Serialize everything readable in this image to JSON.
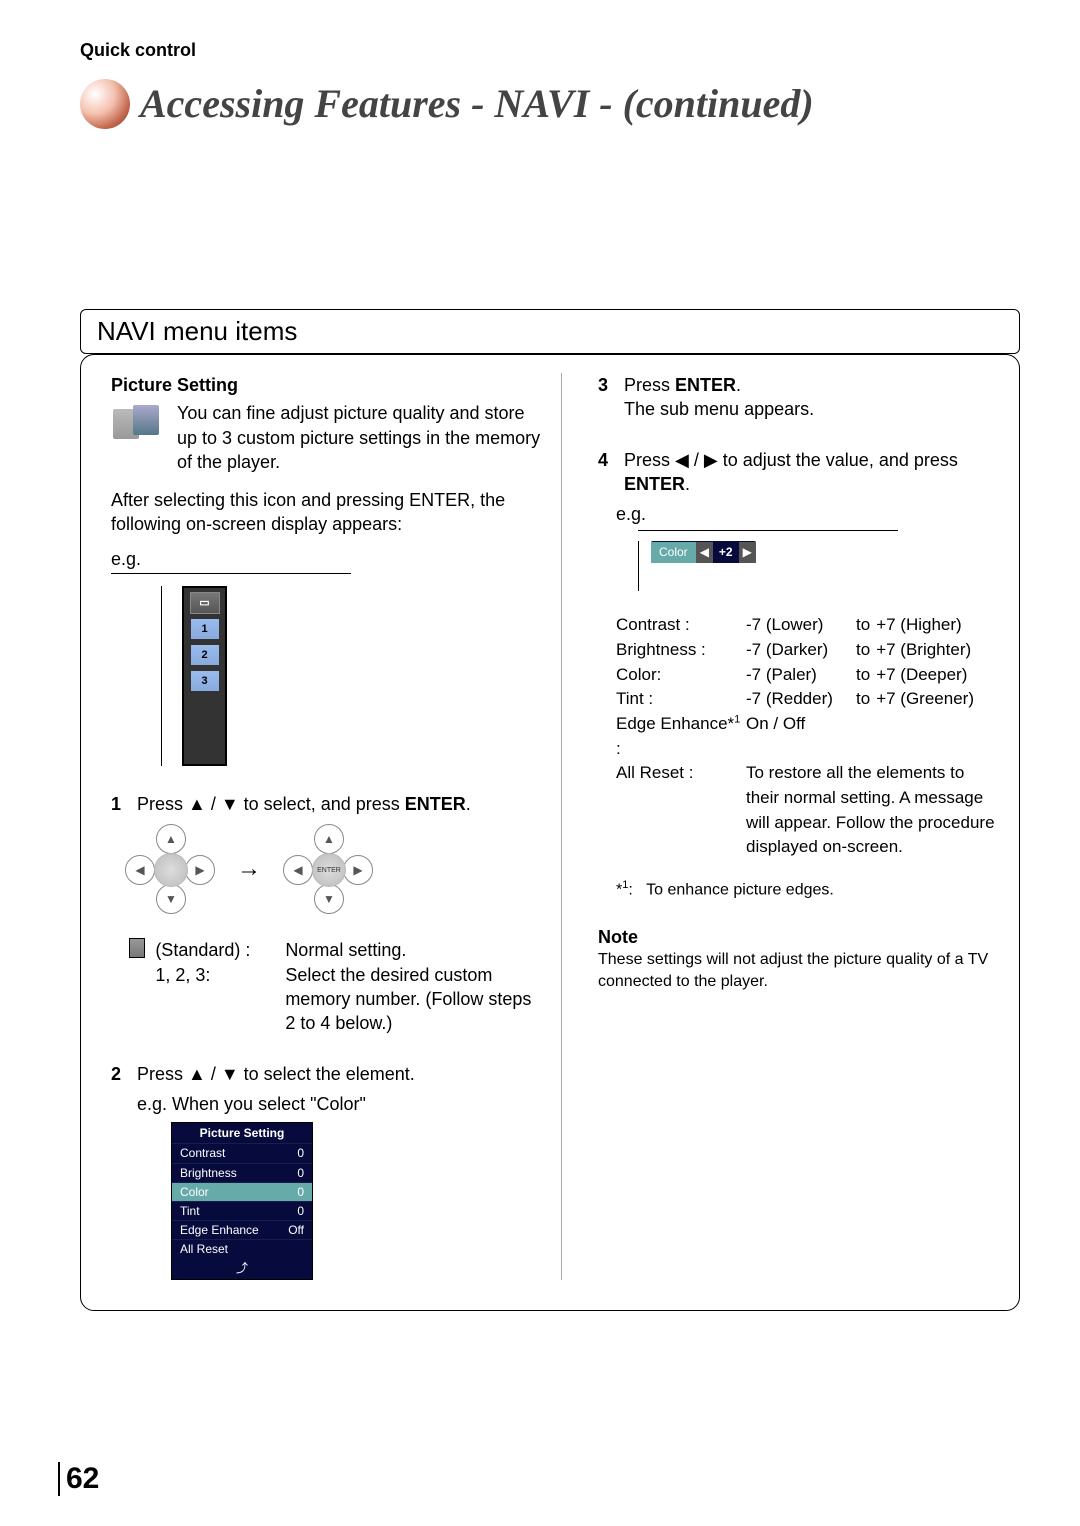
{
  "header": {
    "quick_control": "Quick control",
    "title": "Accessing Features - NAVI - (continued)"
  },
  "section_title": "NAVI menu items",
  "left": {
    "picture_setting_title": "Picture Setting",
    "picture_setting_desc": "You can fine adjust picture quality and store up to 3 custom picture settings in the memory of the player.",
    "after_selecting": "After selecting this icon and pressing ENTER, the following on-screen display appears:",
    "eg": "e.g.",
    "stack": {
      "num1": "1",
      "num2": "2",
      "num3": "3"
    },
    "step1": {
      "n": "1",
      "text_a": "Press ",
      "arrows": "▲ / ▼",
      "text_b": " to select, and press ",
      "enter": "ENTER",
      "period": "."
    },
    "dpad_center_left": "",
    "dpad_center_right": "ENTER",
    "arrow": "→",
    "std": {
      "standard_label": "(Standard) :",
      "standard_desc": "Normal setting.",
      "nums_label": "1, 2, 3:",
      "nums_desc": "Select the desired custom memory number. (Follow steps 2 to 4 below.)"
    },
    "step2": {
      "n": "2",
      "text_a": "Press ",
      "arrows": "▲ / ▼",
      "text_b": " to select the element.",
      "eg_line": "e.g. When you select \"Color\""
    },
    "ps_menu": {
      "title": "Picture Setting",
      "rows": [
        {
          "name": "Contrast",
          "val": "0"
        },
        {
          "name": "Brightness",
          "val": "0"
        },
        {
          "name": "Color",
          "val": "0",
          "selected": true
        },
        {
          "name": "Tint",
          "val": "0"
        },
        {
          "name": "Edge Enhance",
          "val": "Off"
        },
        {
          "name": "All Reset",
          "val": ""
        }
      ],
      "return_icon": "⤴"
    }
  },
  "right": {
    "step3": {
      "n": "3",
      "text_a": "Press ",
      "enter": "ENTER",
      "period": ".",
      "line2": "The sub menu appears."
    },
    "step4": {
      "n": "4",
      "text_a": "Press ",
      "arrows": "◀ / ▶",
      "text_b": " to adjust the value, and press ",
      "enter": "ENTER",
      "period": "."
    },
    "eg": "e.g.",
    "color_pill": {
      "label": "Color",
      "left": "◀",
      "val": "+2",
      "right": "▶"
    },
    "ranges": {
      "contrast": {
        "label": "Contrast :",
        "low": "-7 (Lower)",
        "to": "to",
        "high": "+7 (Higher)"
      },
      "brightness": {
        "label": "Brightness :",
        "low": "-7 (Darker)",
        "to": "to",
        "high": "+7 (Brighter)"
      },
      "color": {
        "label": "Color:",
        "low": "-7 (Paler)",
        "to": "to",
        "high": "+7 (Deeper)"
      },
      "tint": {
        "label": "Tint :",
        "low": "-7 (Redder)",
        "to": "to",
        "high": "+7 (Greener)"
      },
      "edge": {
        "label_a": "Edge Enhance*",
        "sup": "1",
        "label_b": " :",
        "val": "On / Off"
      },
      "allreset": {
        "label": "All Reset :",
        "desc": "To restore all the elements to their normal setting. A message will appear. Follow the procedure displayed on-screen."
      }
    },
    "footnote": {
      "star": "*",
      "sup": "1",
      "colon": ":",
      "text": "To enhance picture edges."
    },
    "note_h": "Note",
    "note_body": "These settings will not adjust the picture quality of a TV connected to the player."
  },
  "page_number": "62"
}
